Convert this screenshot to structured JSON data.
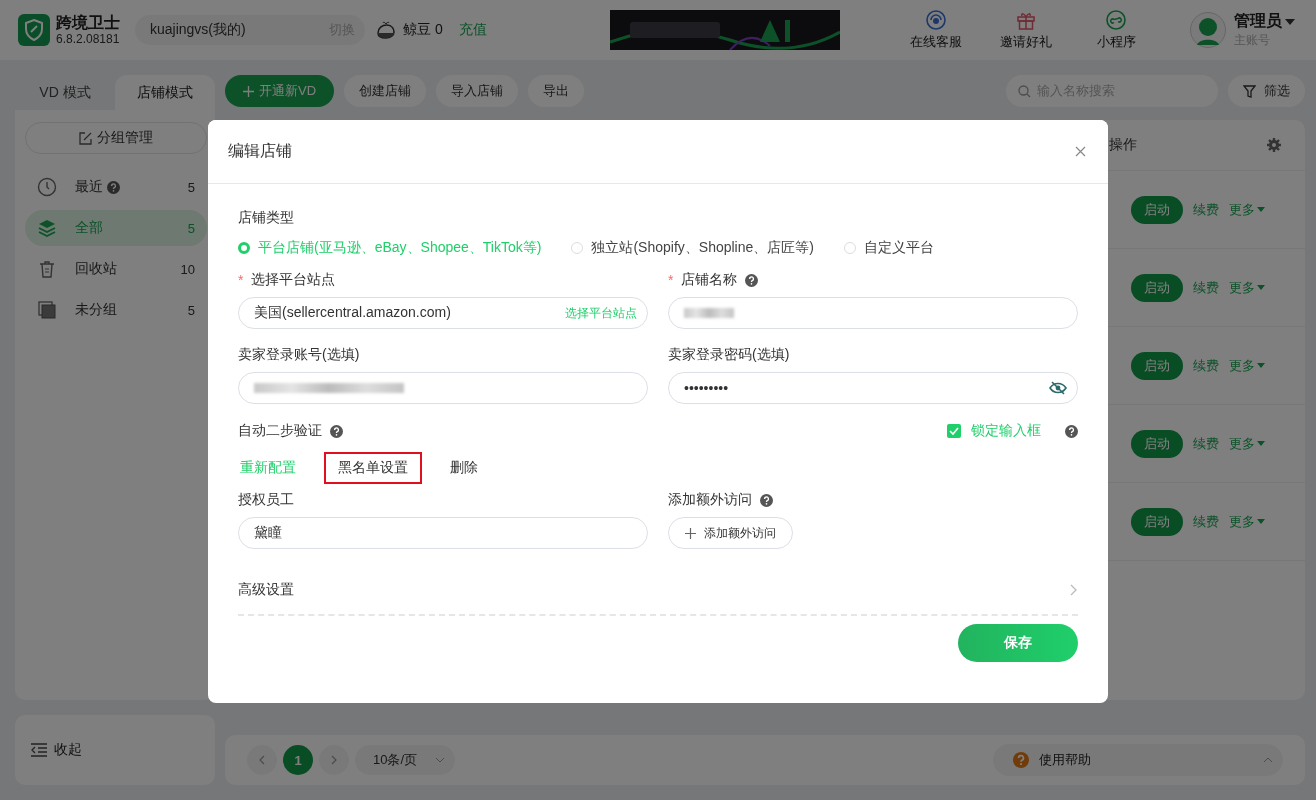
{
  "app": {
    "name": "跨境卫士",
    "version": "6.8.2.08181"
  },
  "account": {
    "name": "kuajingvs(我的)",
    "switch": "切换"
  },
  "beans": {
    "label": "鲸豆 0",
    "recharge": "充值"
  },
  "header_links": [
    {
      "label": "在线客服",
      "kind": "service"
    },
    {
      "label": "邀请好礼",
      "kind": "gift"
    },
    {
      "label": "小程序",
      "kind": "miniapp"
    }
  ],
  "user": {
    "name": "管理员",
    "role": "主账号"
  },
  "mode_tabs": [
    {
      "label": "VD 模式",
      "selected": false
    },
    {
      "label": "店铺模式",
      "selected": true
    }
  ],
  "toolbar_buttons": [
    {
      "label": "开通新VD",
      "kind": "primary"
    },
    {
      "label": "创建店铺",
      "kind": "plain"
    },
    {
      "label": "导入店铺",
      "kind": "plain"
    },
    {
      "label": "导出",
      "kind": "plain"
    }
  ],
  "search": {
    "placeholder": "输入名称搜索"
  },
  "filter": "筛选",
  "sidebar": {
    "group_manage": "分组管理",
    "items": [
      {
        "label": "最近",
        "count": "5",
        "help": true,
        "kind": "clock",
        "selected": false
      },
      {
        "label": "全部",
        "count": "5",
        "help": false,
        "kind": "layers",
        "selected": true
      },
      {
        "label": "回收站",
        "count": "10",
        "help": false,
        "kind": "trash",
        "selected": false
      },
      {
        "label": "未分组",
        "count": "5",
        "help": false,
        "kind": "square",
        "selected": false
      }
    ],
    "collapse": "收起"
  },
  "table": {
    "columns": [
      "操作"
    ],
    "rows": [
      {
        "actions": [
          "启动",
          "续费",
          "更多"
        ]
      },
      {
        "actions": [
          "启动",
          "续费",
          "更多"
        ]
      },
      {
        "actions": [
          "启动",
          "续费",
          "更多"
        ]
      },
      {
        "actions": [
          "启动",
          "续费",
          "更多"
        ]
      },
      {
        "actions": [
          "启动",
          "续费",
          "更多"
        ]
      }
    ]
  },
  "pagination": {
    "pages": [
      {
        "label": "1",
        "selected": true
      }
    ],
    "page_size": "10条/页"
  },
  "help": "使用帮助",
  "dialog": {
    "title": "编辑店铺",
    "store_type": {
      "label": "店铺类型",
      "options": [
        {
          "label": "平台店铺(亚马逊、eBay、Shopee、TikTok等)",
          "selected": true
        },
        {
          "label": "独立站(Shopify、Shopline、店匠等)",
          "selected": false
        },
        {
          "label": "自定义平台",
          "selected": false
        }
      ]
    },
    "fields": [
      {
        "label": "选择平台站点",
        "required_mark": "*",
        "help": false,
        "value": "美国(sellercentral.amazon.com)",
        "action": "选择平台站点",
        "kind": "text"
      },
      {
        "label": "店铺名称",
        "required_mark": "*",
        "help": true,
        "kind": "blurred"
      },
      {
        "label": "卖家登录账号(选填)",
        "help": false,
        "kind": "blurred"
      },
      {
        "label": "卖家登录密码(选填)",
        "help": false,
        "value": "•••••••••",
        "kind": "password"
      }
    ],
    "two_step": {
      "label": "自动二步验证",
      "actions": [
        {
          "label": "重新配置",
          "kind": "link",
          "highlighted": false
        },
        {
          "label": "黑名单设置",
          "kind": "plain",
          "highlighted": true
        },
        {
          "label": "删除",
          "kind": "plain",
          "highlighted": false
        }
      ]
    },
    "lock_input": {
      "label": "锁定输入框",
      "checked": true
    },
    "staff": {
      "label": "授权员工",
      "value": "黛瞳"
    },
    "extra_access": {
      "label": "添加额外访问",
      "button": "添加额外访问"
    },
    "advanced": "高级设置",
    "save": "保存"
  }
}
